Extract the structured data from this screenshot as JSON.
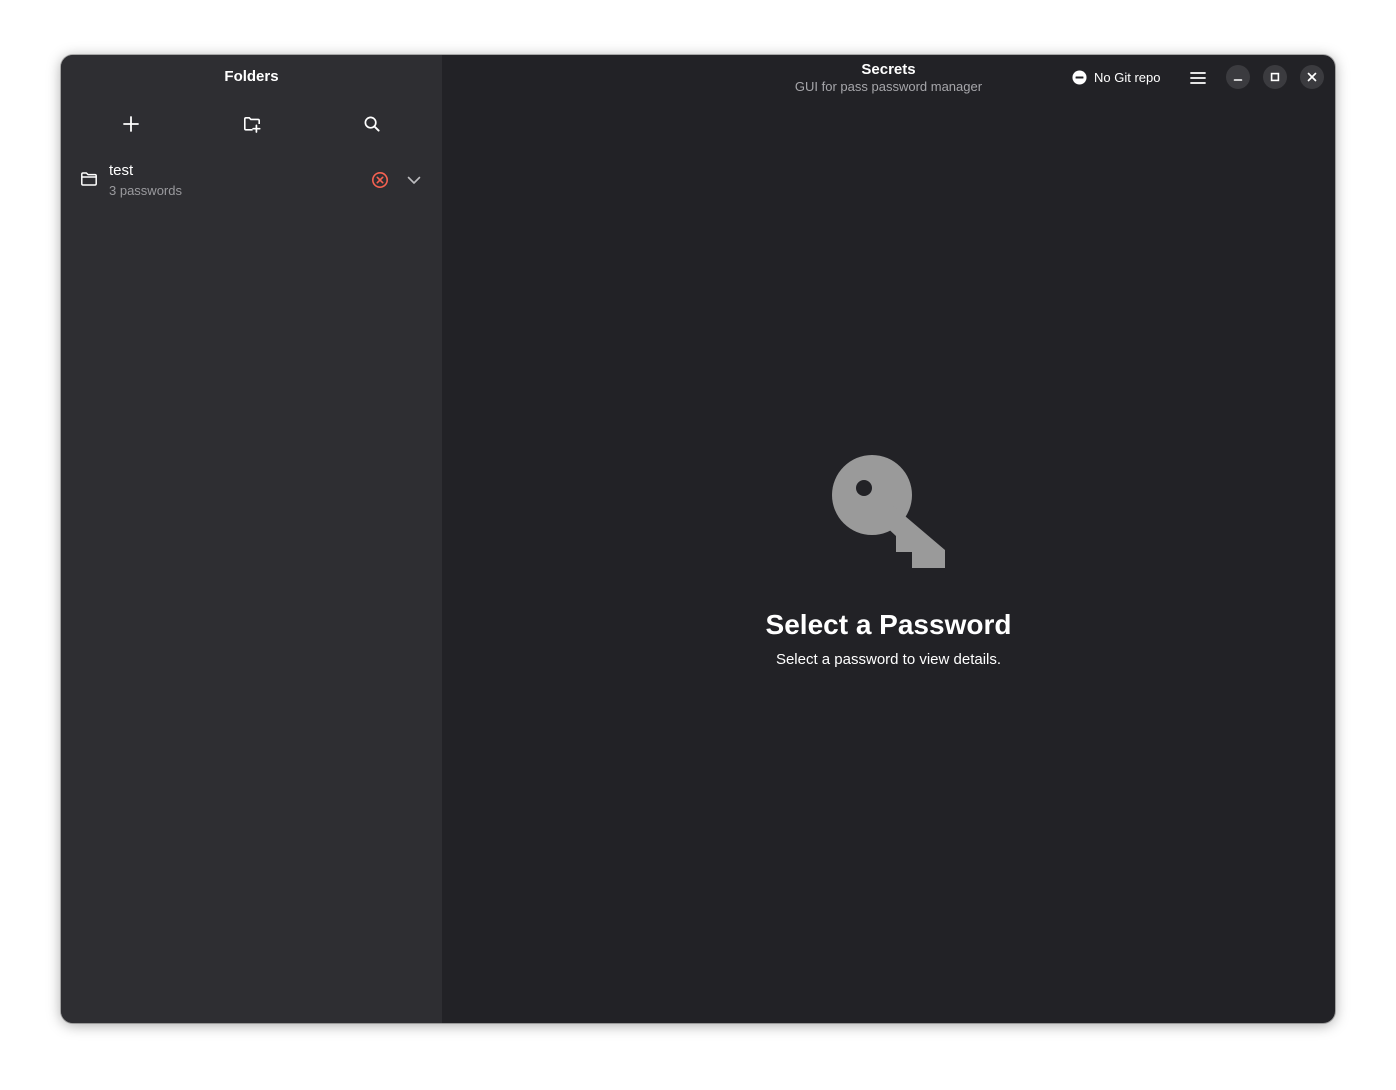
{
  "sidebar": {
    "title": "Folders",
    "toolbar": {
      "add_icon": "plus-icon",
      "new_folder_icon": "folder-new-icon",
      "search_icon": "search-icon"
    },
    "folders": [
      {
        "name": "test",
        "count_label": "3 passwords",
        "status_icon": "error-icon",
        "status_color": "#f66151",
        "expand_icon": "chevron-down-icon"
      }
    ]
  },
  "header": {
    "title": "Secrets",
    "subtitle": "GUI for pass password manager",
    "git_status": "No Git repo",
    "git_icon": "no-entry-icon",
    "menu_icon": "hamburger-menu-icon"
  },
  "window_controls": {
    "minimize_icon": "minimize-icon",
    "maximize_icon": "maximize-icon",
    "close_icon": "close-icon"
  },
  "empty_state": {
    "icon": "key-icon",
    "title": "Select a Password",
    "description": "Select a password to view details."
  },
  "colors": {
    "sidebar_bg": "#2e2e32",
    "content_bg": "#222226",
    "error": "#f66151",
    "icon_gray": "#9a9a9a"
  }
}
